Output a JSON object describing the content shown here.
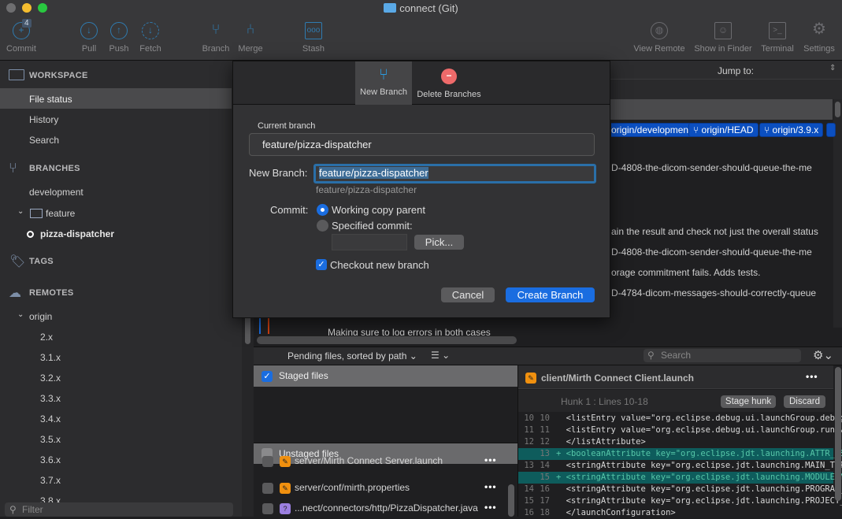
{
  "window": {
    "title": "connect (Git)"
  },
  "toolbar": {
    "commit": "Commit",
    "commit_badge": "4",
    "pull": "Pull",
    "push": "Push",
    "fetch": "Fetch",
    "branch": "Branch",
    "merge": "Merge",
    "stash": "Stash",
    "view_remote": "View Remote",
    "show_in_finder": "Show in Finder",
    "terminal": "Terminal",
    "settings": "Settings"
  },
  "sidebar": {
    "workspace": "WORKSPACE",
    "file_status": "File status",
    "history": "History",
    "search": "Search",
    "branches": "BRANCHES",
    "development": "development",
    "feature": "feature",
    "pizza": "pizza-dispatcher",
    "tags": "TAGS",
    "remotes": "REMOTES",
    "origin": "origin",
    "remote_branches": [
      "2.x",
      "3.1.x",
      "3.2.x",
      "3.3.x",
      "3.4.x",
      "3.5.x",
      "3.6.x",
      "3.7.x",
      "3.8.x"
    ],
    "filter_placeholder": "Filter"
  },
  "history": {
    "jump_to": "Jump to:",
    "tags": [
      "origin/development",
      "origin/HEAD",
      "origin/3.9.x"
    ],
    "lines": [
      "D-4808-the-dicom-sender-should-queue-the-me",
      "ain the result and check not just the overall status",
      "D-4808-the-dicom-sender-should-queue-the-me",
      "orage commitment fails. Adds tests.",
      "D-4784-dicom-messages-should-correctly-queue",
      "Making sure to log errors in both cases"
    ]
  },
  "dialog": {
    "tab_new": "New Branch",
    "tab_delete": "Delete Branches",
    "current_label": "Current branch",
    "current_value": "feature/pizza-dispatcher",
    "new_label": "New Branch:",
    "new_value": "feature/pizza-dispatcher",
    "new_hint": "feature/pizza-dispatcher",
    "commit_label": "Commit:",
    "opt_working": "Working copy parent",
    "opt_specified": "Specified commit:",
    "pick": "Pick...",
    "checkout": "Checkout new branch",
    "cancel": "Cancel",
    "create": "Create Branch"
  },
  "files": {
    "sort_label": "Pending files, sorted by path",
    "search_placeholder": "Search",
    "staged": "Staged files",
    "unstaged": "Unstaged files",
    "items": [
      {
        "path": "server/Mirth Connect Server.launch",
        "status": "modified"
      },
      {
        "path": "server/conf/mirth.properties",
        "status": "modified"
      },
      {
        "path": "...nect/connectors/http/PizzaDispatcher.java",
        "status": "untracked"
      }
    ]
  },
  "diff": {
    "file": "client/Mirth Connect Client.launch",
    "hunk": "Hunk 1 : Lines 10-18",
    "stage_hunk": "Stage hunk",
    "discard": "Discard",
    "lines": [
      {
        "old": "10",
        "new": "10",
        "type": "ctx",
        "text": "  <listEntry value=\"org.eclipse.debug.ui.launchGroup.debug"
      },
      {
        "old": "11",
        "new": "11",
        "type": "ctx",
        "text": "  <listEntry value=\"org.eclipse.debug.ui.launchGroup.run\"/"
      },
      {
        "old": "12",
        "new": "12",
        "type": "ctx",
        "text": "  </listAttribute>"
      },
      {
        "old": "",
        "new": "13",
        "type": "add",
        "text": "+ <booleanAttribute key=\"org.eclipse.jdt.launching.ATTR_US"
      },
      {
        "old": "13",
        "new": "14",
        "type": "ctx",
        "text": "  <stringAttribute key=\"org.eclipse.jdt.launching.MAIN_TYP"
      },
      {
        "old": "",
        "new": "15",
        "type": "add",
        "text": "+ <stringAttribute key=\"org.eclipse.jdt.launching.MODULE_N"
      },
      {
        "old": "14",
        "new": "16",
        "type": "ctx",
        "text": "  <stringAttribute key=\"org.eclipse.jdt.launching.PROGRAM_"
      },
      {
        "old": "15",
        "new": "17",
        "type": "ctx",
        "text": "  <stringAttribute key=\"org.eclipse.jdt.launching.PROJECT_"
      },
      {
        "old": "16",
        "new": "18",
        "type": "ctx",
        "text": "  </launchConfiguration>"
      }
    ]
  },
  "colors": {
    "accent": "#1a6de0",
    "tag": "#0b4fc0",
    "added_line": "#0e5c5c",
    "modified_icon": "#f0900f",
    "untracked_icon": "#9b7fe0"
  }
}
